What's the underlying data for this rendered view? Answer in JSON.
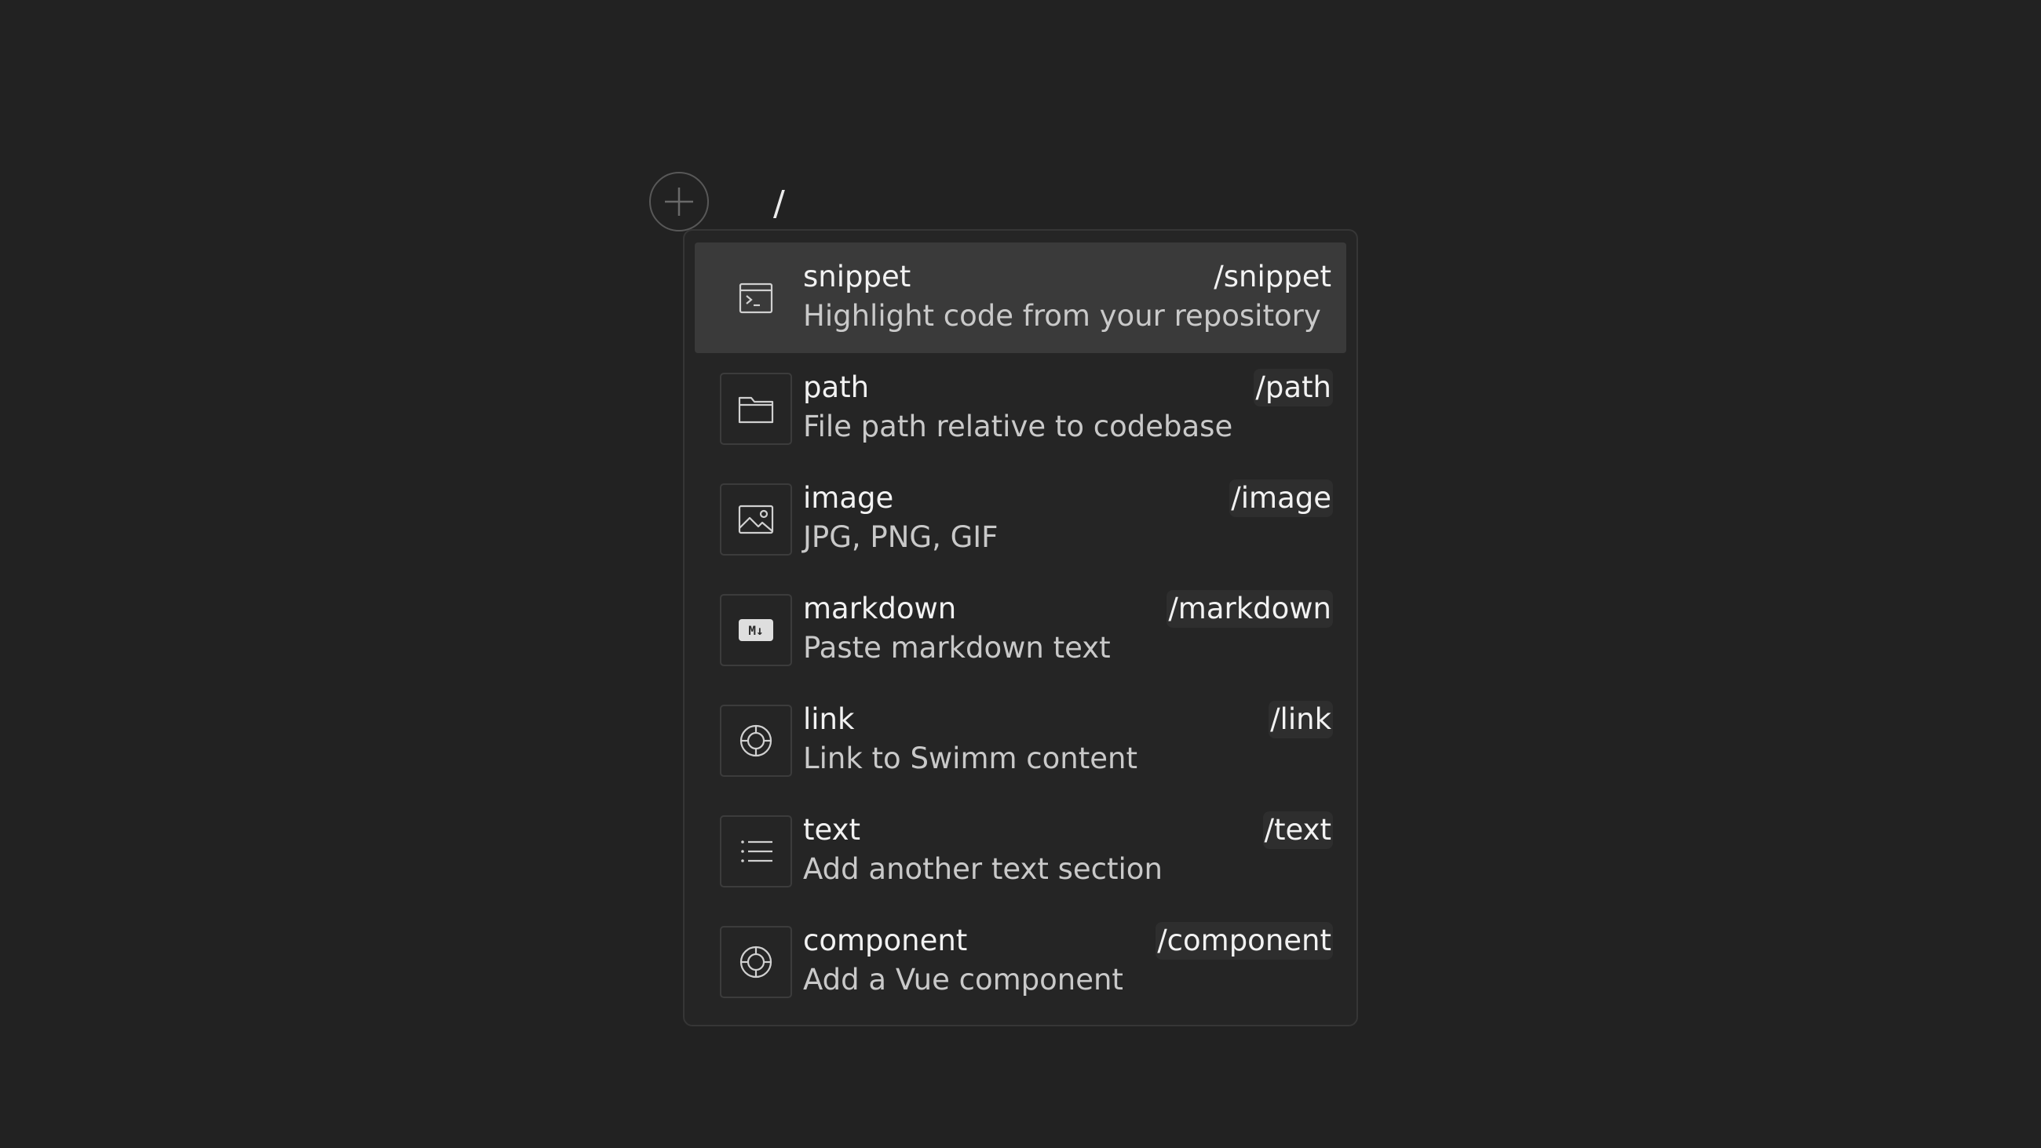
{
  "editor": {
    "input_value": "/",
    "add_icon": "plus-circle-icon"
  },
  "menu": {
    "items": [
      {
        "title": "snippet",
        "description": "Highlight code from your repository",
        "shortcut": "/snippet",
        "icon": "terminal-window-icon",
        "active": true
      },
      {
        "title": "path",
        "description": "File path relative to codebase",
        "shortcut": "/path",
        "icon": "folder-icon",
        "active": false
      },
      {
        "title": "image",
        "description": "JPG, PNG, GIF",
        "shortcut": "/image",
        "icon": "image-icon",
        "active": false
      },
      {
        "title": "markdown",
        "description": "Paste markdown text",
        "shortcut": "/markdown",
        "icon": "markdown-icon",
        "active": false
      },
      {
        "title": "link",
        "description": "Link to Swimm content",
        "shortcut": "/link",
        "icon": "swimm-link-icon",
        "active": false
      },
      {
        "title": "text",
        "description": "Add another text section",
        "shortcut": "/text",
        "icon": "list-icon",
        "active": false
      },
      {
        "title": "component",
        "description": "Add a Vue component",
        "shortcut": "/component",
        "icon": "component-icon",
        "active": false
      }
    ]
  },
  "colors": {
    "background": "#222222",
    "menu_background": "#252525",
    "active_item": "#3a3a3a",
    "text_primary": "#f2f2f2",
    "text_secondary": "#c9c9c9"
  }
}
